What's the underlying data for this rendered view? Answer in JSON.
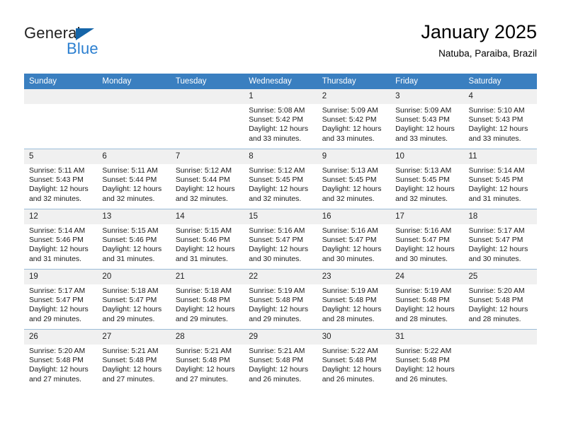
{
  "brand": {
    "name_top": "General",
    "name_bottom": "Blue",
    "triangle_color": "#1565a8",
    "blue_color": "#2b7fd0"
  },
  "header": {
    "title": "January 2025",
    "subtitle": "Natuba, Paraiba, Brazil"
  },
  "theme": {
    "header_bg": "#3a7fc0",
    "header_text": "#ffffff",
    "date_band_bg": "#f0f0f0",
    "grid_line": "#9bbcd8",
    "cell_bg": "#ffffff"
  },
  "weekdays": [
    "Sunday",
    "Monday",
    "Tuesday",
    "Wednesday",
    "Thursday",
    "Friday",
    "Saturday"
  ],
  "labels": {
    "sunrise_prefix": "Sunrise: ",
    "sunset_prefix": "Sunset: ",
    "daylight_prefix": "Daylight: "
  },
  "weeks": [
    [
      {
        "blank": true,
        "date": ""
      },
      {
        "blank": true,
        "date": ""
      },
      {
        "blank": true,
        "date": ""
      },
      {
        "blank": false,
        "date": "1",
        "sunrise": "Sunrise: 5:08 AM",
        "sunset": "Sunset: 5:42 PM",
        "daylight": "Daylight: 12 hours and 33 minutes."
      },
      {
        "blank": false,
        "date": "2",
        "sunrise": "Sunrise: 5:09 AM",
        "sunset": "Sunset: 5:42 PM",
        "daylight": "Daylight: 12 hours and 33 minutes."
      },
      {
        "blank": false,
        "date": "3",
        "sunrise": "Sunrise: 5:09 AM",
        "sunset": "Sunset: 5:43 PM",
        "daylight": "Daylight: 12 hours and 33 minutes."
      },
      {
        "blank": false,
        "date": "4",
        "sunrise": "Sunrise: 5:10 AM",
        "sunset": "Sunset: 5:43 PM",
        "daylight": "Daylight: 12 hours and 33 minutes."
      }
    ],
    [
      {
        "blank": false,
        "date": "5",
        "sunrise": "Sunrise: 5:11 AM",
        "sunset": "Sunset: 5:43 PM",
        "daylight": "Daylight: 12 hours and 32 minutes."
      },
      {
        "blank": false,
        "date": "6",
        "sunrise": "Sunrise: 5:11 AM",
        "sunset": "Sunset: 5:44 PM",
        "daylight": "Daylight: 12 hours and 32 minutes."
      },
      {
        "blank": false,
        "date": "7",
        "sunrise": "Sunrise: 5:12 AM",
        "sunset": "Sunset: 5:44 PM",
        "daylight": "Daylight: 12 hours and 32 minutes."
      },
      {
        "blank": false,
        "date": "8",
        "sunrise": "Sunrise: 5:12 AM",
        "sunset": "Sunset: 5:45 PM",
        "daylight": "Daylight: 12 hours and 32 minutes."
      },
      {
        "blank": false,
        "date": "9",
        "sunrise": "Sunrise: 5:13 AM",
        "sunset": "Sunset: 5:45 PM",
        "daylight": "Daylight: 12 hours and 32 minutes."
      },
      {
        "blank": false,
        "date": "10",
        "sunrise": "Sunrise: 5:13 AM",
        "sunset": "Sunset: 5:45 PM",
        "daylight": "Daylight: 12 hours and 32 minutes."
      },
      {
        "blank": false,
        "date": "11",
        "sunrise": "Sunrise: 5:14 AM",
        "sunset": "Sunset: 5:45 PM",
        "daylight": "Daylight: 12 hours and 31 minutes."
      }
    ],
    [
      {
        "blank": false,
        "date": "12",
        "sunrise": "Sunrise: 5:14 AM",
        "sunset": "Sunset: 5:46 PM",
        "daylight": "Daylight: 12 hours and 31 minutes."
      },
      {
        "blank": false,
        "date": "13",
        "sunrise": "Sunrise: 5:15 AM",
        "sunset": "Sunset: 5:46 PM",
        "daylight": "Daylight: 12 hours and 31 minutes."
      },
      {
        "blank": false,
        "date": "14",
        "sunrise": "Sunrise: 5:15 AM",
        "sunset": "Sunset: 5:46 PM",
        "daylight": "Daylight: 12 hours and 31 minutes."
      },
      {
        "blank": false,
        "date": "15",
        "sunrise": "Sunrise: 5:16 AM",
        "sunset": "Sunset: 5:47 PM",
        "daylight": "Daylight: 12 hours and 30 minutes."
      },
      {
        "blank": false,
        "date": "16",
        "sunrise": "Sunrise: 5:16 AM",
        "sunset": "Sunset: 5:47 PM",
        "daylight": "Daylight: 12 hours and 30 minutes."
      },
      {
        "blank": false,
        "date": "17",
        "sunrise": "Sunrise: 5:16 AM",
        "sunset": "Sunset: 5:47 PM",
        "daylight": "Daylight: 12 hours and 30 minutes."
      },
      {
        "blank": false,
        "date": "18",
        "sunrise": "Sunrise: 5:17 AM",
        "sunset": "Sunset: 5:47 PM",
        "daylight": "Daylight: 12 hours and 30 minutes."
      }
    ],
    [
      {
        "blank": false,
        "date": "19",
        "sunrise": "Sunrise: 5:17 AM",
        "sunset": "Sunset: 5:47 PM",
        "daylight": "Daylight: 12 hours and 29 minutes."
      },
      {
        "blank": false,
        "date": "20",
        "sunrise": "Sunrise: 5:18 AM",
        "sunset": "Sunset: 5:47 PM",
        "daylight": "Daylight: 12 hours and 29 minutes."
      },
      {
        "blank": false,
        "date": "21",
        "sunrise": "Sunrise: 5:18 AM",
        "sunset": "Sunset: 5:48 PM",
        "daylight": "Daylight: 12 hours and 29 minutes."
      },
      {
        "blank": false,
        "date": "22",
        "sunrise": "Sunrise: 5:19 AM",
        "sunset": "Sunset: 5:48 PM",
        "daylight": "Daylight: 12 hours and 29 minutes."
      },
      {
        "blank": false,
        "date": "23",
        "sunrise": "Sunrise: 5:19 AM",
        "sunset": "Sunset: 5:48 PM",
        "daylight": "Daylight: 12 hours and 28 minutes."
      },
      {
        "blank": false,
        "date": "24",
        "sunrise": "Sunrise: 5:19 AM",
        "sunset": "Sunset: 5:48 PM",
        "daylight": "Daylight: 12 hours and 28 minutes."
      },
      {
        "blank": false,
        "date": "25",
        "sunrise": "Sunrise: 5:20 AM",
        "sunset": "Sunset: 5:48 PM",
        "daylight": "Daylight: 12 hours and 28 minutes."
      }
    ],
    [
      {
        "blank": false,
        "date": "26",
        "sunrise": "Sunrise: 5:20 AM",
        "sunset": "Sunset: 5:48 PM",
        "daylight": "Daylight: 12 hours and 27 minutes."
      },
      {
        "blank": false,
        "date": "27",
        "sunrise": "Sunrise: 5:21 AM",
        "sunset": "Sunset: 5:48 PM",
        "daylight": "Daylight: 12 hours and 27 minutes."
      },
      {
        "blank": false,
        "date": "28",
        "sunrise": "Sunrise: 5:21 AM",
        "sunset": "Sunset: 5:48 PM",
        "daylight": "Daylight: 12 hours and 27 minutes."
      },
      {
        "blank": false,
        "date": "29",
        "sunrise": "Sunrise: 5:21 AM",
        "sunset": "Sunset: 5:48 PM",
        "daylight": "Daylight: 12 hours and 26 minutes."
      },
      {
        "blank": false,
        "date": "30",
        "sunrise": "Sunrise: 5:22 AM",
        "sunset": "Sunset: 5:48 PM",
        "daylight": "Daylight: 12 hours and 26 minutes."
      },
      {
        "blank": false,
        "date": "31",
        "sunrise": "Sunrise: 5:22 AM",
        "sunset": "Sunset: 5:48 PM",
        "daylight": "Daylight: 12 hours and 26 minutes."
      },
      {
        "blank": true,
        "date": ""
      }
    ]
  ]
}
